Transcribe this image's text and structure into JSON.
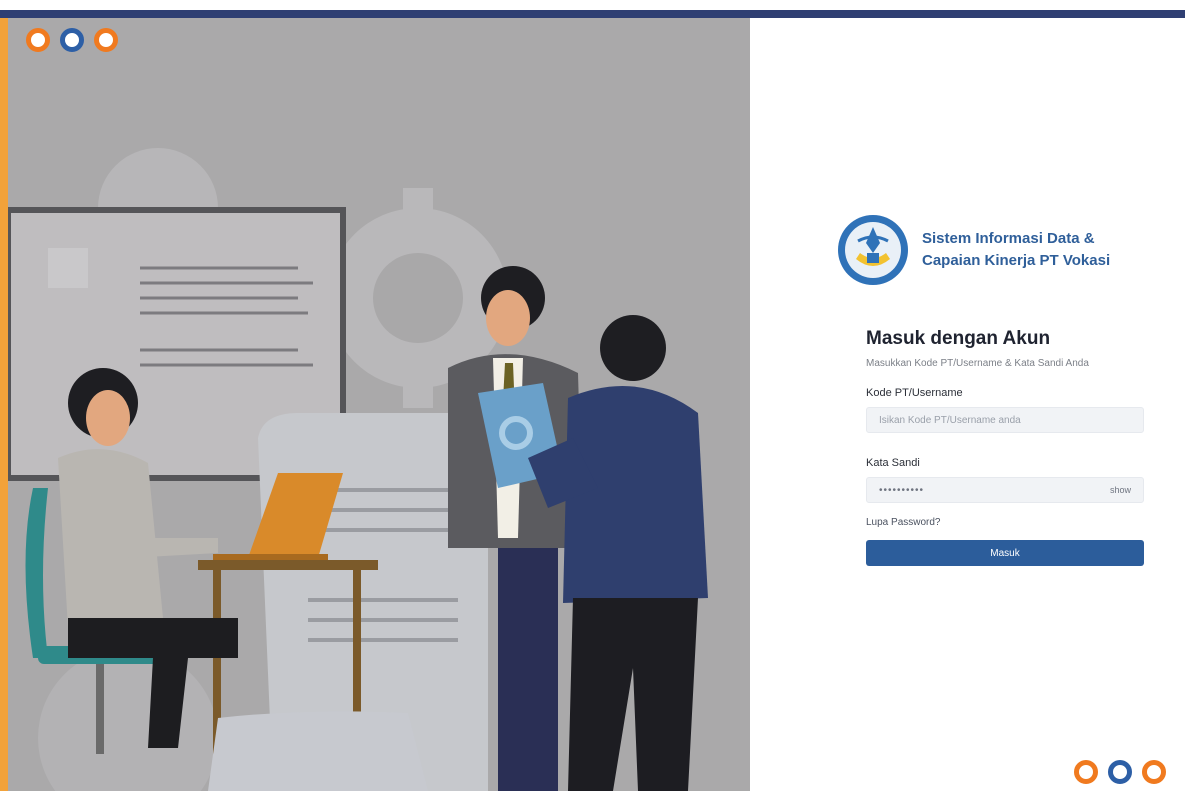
{
  "brand": {
    "title_line1": "Sistem Informasi Data &",
    "title_line2": "Capaian Kinerja PT Vokasi",
    "logo_icon": "tut-wuri-handayani-logo-icon"
  },
  "login": {
    "heading": "Masuk dengan Akun",
    "subheading": "Masukkan Kode PT/Username & Kata Sandi Anda",
    "username_label": "Kode PT/Username",
    "username_placeholder": "Isikan Kode PT/Username anda",
    "password_label": "Kata Sandi",
    "password_value": "••••••••••",
    "show_label": "show",
    "forgot_label": "Lupa Password?",
    "submit_label": "Masuk"
  },
  "colors": {
    "accent_blue": "#2c5d9b",
    "top_bar": "#2f3f73",
    "left_stripe": "#f2a23a",
    "ring_orange": "#f07a1f",
    "ring_blue": "#2d5fa6"
  }
}
